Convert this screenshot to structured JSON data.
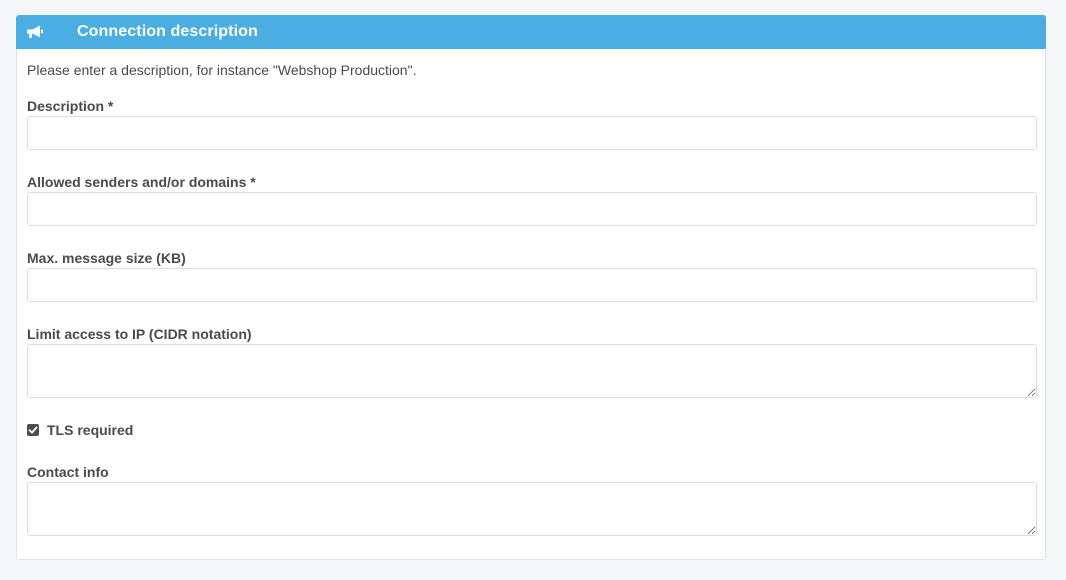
{
  "panel": {
    "title": "Connection description",
    "header_icon": "bullhorn-icon",
    "header_color": "#4aaee3",
    "intro": "Please enter a description, for instance \"Webshop Production\"."
  },
  "fields": {
    "description": {
      "label": "Description *",
      "value": ""
    },
    "allowed_senders": {
      "label": "Allowed senders and/or domains *",
      "value": ""
    },
    "max_message_size": {
      "label": "Max. message size (KB)",
      "value": ""
    },
    "limit_access_ip": {
      "label": "Limit access to IP (CIDR notation)",
      "value": ""
    },
    "tls_required": {
      "label": "TLS required",
      "checked": true
    },
    "contact_info": {
      "label": "Contact info",
      "value": ""
    }
  }
}
